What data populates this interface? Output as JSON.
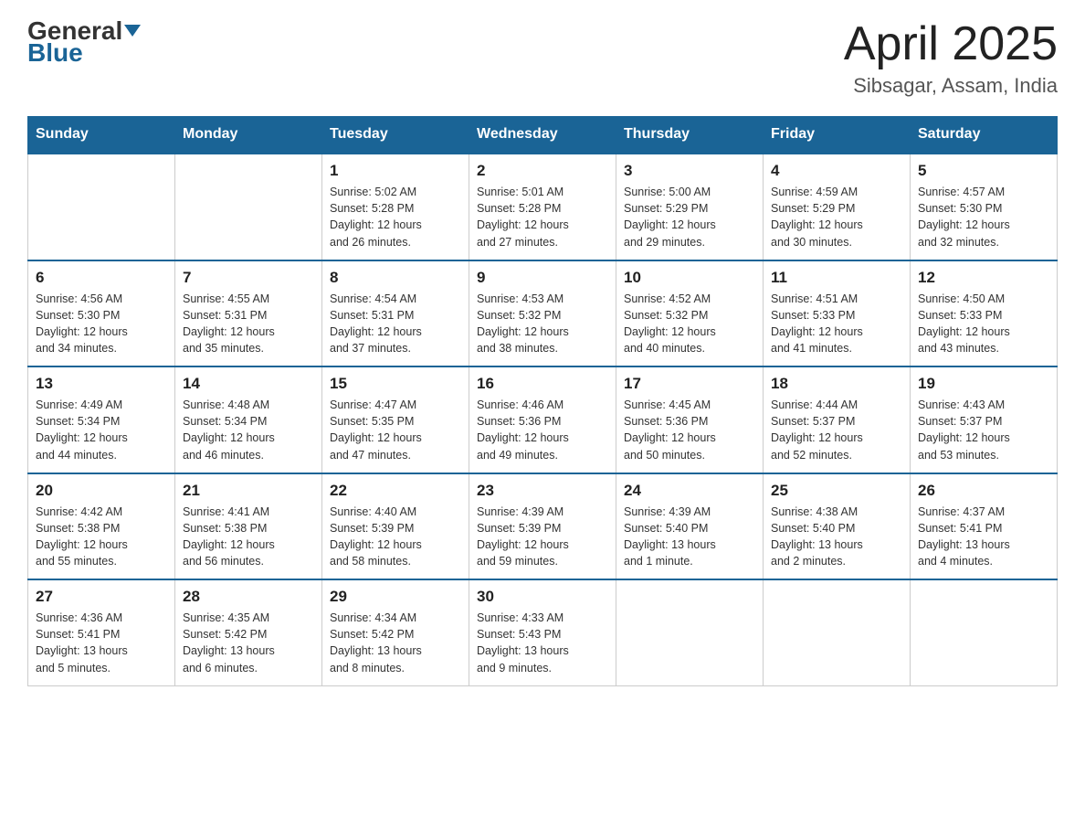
{
  "header": {
    "logo_general": "General",
    "logo_blue": "Blue",
    "month_year": "April 2025",
    "location": "Sibsagar, Assam, India"
  },
  "weekdays": [
    "Sunday",
    "Monday",
    "Tuesday",
    "Wednesday",
    "Thursday",
    "Friday",
    "Saturday"
  ],
  "weeks": [
    [
      {
        "day": "",
        "info": ""
      },
      {
        "day": "",
        "info": ""
      },
      {
        "day": "1",
        "info": "Sunrise: 5:02 AM\nSunset: 5:28 PM\nDaylight: 12 hours\nand 26 minutes."
      },
      {
        "day": "2",
        "info": "Sunrise: 5:01 AM\nSunset: 5:28 PM\nDaylight: 12 hours\nand 27 minutes."
      },
      {
        "day": "3",
        "info": "Sunrise: 5:00 AM\nSunset: 5:29 PM\nDaylight: 12 hours\nand 29 minutes."
      },
      {
        "day": "4",
        "info": "Sunrise: 4:59 AM\nSunset: 5:29 PM\nDaylight: 12 hours\nand 30 minutes."
      },
      {
        "day": "5",
        "info": "Sunrise: 4:57 AM\nSunset: 5:30 PM\nDaylight: 12 hours\nand 32 minutes."
      }
    ],
    [
      {
        "day": "6",
        "info": "Sunrise: 4:56 AM\nSunset: 5:30 PM\nDaylight: 12 hours\nand 34 minutes."
      },
      {
        "day": "7",
        "info": "Sunrise: 4:55 AM\nSunset: 5:31 PM\nDaylight: 12 hours\nand 35 minutes."
      },
      {
        "day": "8",
        "info": "Sunrise: 4:54 AM\nSunset: 5:31 PM\nDaylight: 12 hours\nand 37 minutes."
      },
      {
        "day": "9",
        "info": "Sunrise: 4:53 AM\nSunset: 5:32 PM\nDaylight: 12 hours\nand 38 minutes."
      },
      {
        "day": "10",
        "info": "Sunrise: 4:52 AM\nSunset: 5:32 PM\nDaylight: 12 hours\nand 40 minutes."
      },
      {
        "day": "11",
        "info": "Sunrise: 4:51 AM\nSunset: 5:33 PM\nDaylight: 12 hours\nand 41 minutes."
      },
      {
        "day": "12",
        "info": "Sunrise: 4:50 AM\nSunset: 5:33 PM\nDaylight: 12 hours\nand 43 minutes."
      }
    ],
    [
      {
        "day": "13",
        "info": "Sunrise: 4:49 AM\nSunset: 5:34 PM\nDaylight: 12 hours\nand 44 minutes."
      },
      {
        "day": "14",
        "info": "Sunrise: 4:48 AM\nSunset: 5:34 PM\nDaylight: 12 hours\nand 46 minutes."
      },
      {
        "day": "15",
        "info": "Sunrise: 4:47 AM\nSunset: 5:35 PM\nDaylight: 12 hours\nand 47 minutes."
      },
      {
        "day": "16",
        "info": "Sunrise: 4:46 AM\nSunset: 5:36 PM\nDaylight: 12 hours\nand 49 minutes."
      },
      {
        "day": "17",
        "info": "Sunrise: 4:45 AM\nSunset: 5:36 PM\nDaylight: 12 hours\nand 50 minutes."
      },
      {
        "day": "18",
        "info": "Sunrise: 4:44 AM\nSunset: 5:37 PM\nDaylight: 12 hours\nand 52 minutes."
      },
      {
        "day": "19",
        "info": "Sunrise: 4:43 AM\nSunset: 5:37 PM\nDaylight: 12 hours\nand 53 minutes."
      }
    ],
    [
      {
        "day": "20",
        "info": "Sunrise: 4:42 AM\nSunset: 5:38 PM\nDaylight: 12 hours\nand 55 minutes."
      },
      {
        "day": "21",
        "info": "Sunrise: 4:41 AM\nSunset: 5:38 PM\nDaylight: 12 hours\nand 56 minutes."
      },
      {
        "day": "22",
        "info": "Sunrise: 4:40 AM\nSunset: 5:39 PM\nDaylight: 12 hours\nand 58 minutes."
      },
      {
        "day": "23",
        "info": "Sunrise: 4:39 AM\nSunset: 5:39 PM\nDaylight: 12 hours\nand 59 minutes."
      },
      {
        "day": "24",
        "info": "Sunrise: 4:39 AM\nSunset: 5:40 PM\nDaylight: 13 hours\nand 1 minute."
      },
      {
        "day": "25",
        "info": "Sunrise: 4:38 AM\nSunset: 5:40 PM\nDaylight: 13 hours\nand 2 minutes."
      },
      {
        "day": "26",
        "info": "Sunrise: 4:37 AM\nSunset: 5:41 PM\nDaylight: 13 hours\nand 4 minutes."
      }
    ],
    [
      {
        "day": "27",
        "info": "Sunrise: 4:36 AM\nSunset: 5:41 PM\nDaylight: 13 hours\nand 5 minutes."
      },
      {
        "day": "28",
        "info": "Sunrise: 4:35 AM\nSunset: 5:42 PM\nDaylight: 13 hours\nand 6 minutes."
      },
      {
        "day": "29",
        "info": "Sunrise: 4:34 AM\nSunset: 5:42 PM\nDaylight: 13 hours\nand 8 minutes."
      },
      {
        "day": "30",
        "info": "Sunrise: 4:33 AM\nSunset: 5:43 PM\nDaylight: 13 hours\nand 9 minutes."
      },
      {
        "day": "",
        "info": ""
      },
      {
        "day": "",
        "info": ""
      },
      {
        "day": "",
        "info": ""
      }
    ]
  ]
}
